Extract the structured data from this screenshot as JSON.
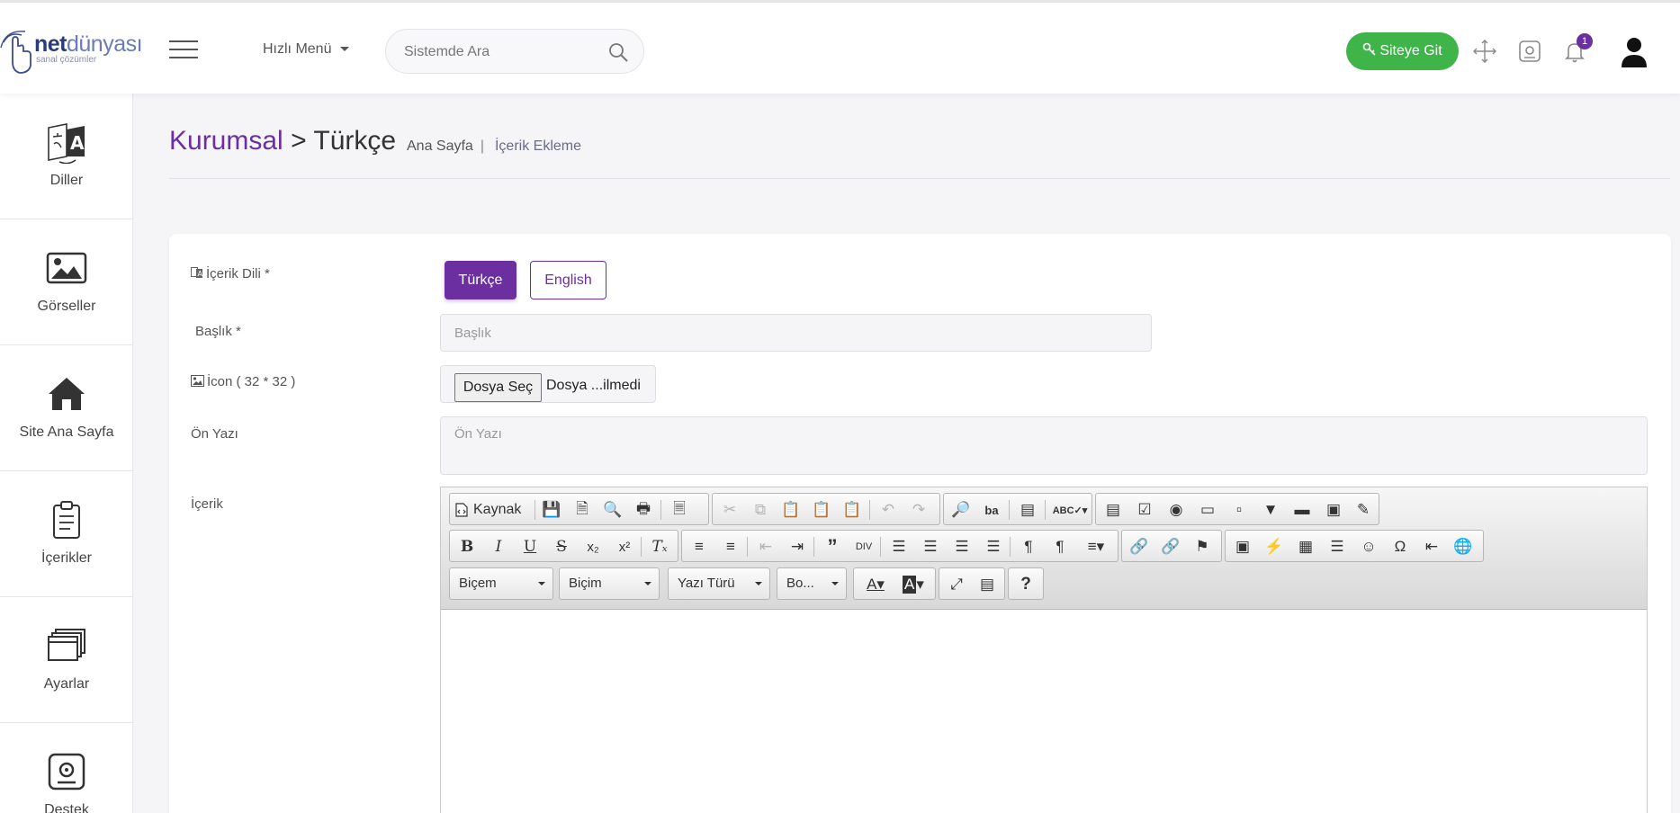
{
  "header": {
    "logo_bold": "net",
    "logo_light": "dünyası",
    "logo_sub": "sanal çözümler",
    "quick_menu": "Hızlı Menü",
    "search_placeholder": "Sistemde Ara",
    "site_button": "Siteye Git",
    "notification_count": "1"
  },
  "sidebar": {
    "items": [
      {
        "label": "Diller",
        "icon": "translate-icon"
      },
      {
        "label": "Görseller",
        "icon": "image-icon"
      },
      {
        "label": "Site Ana Sayfa",
        "icon": "home-icon"
      },
      {
        "label": "İçerikler",
        "icon": "clipboard-icon"
      },
      {
        "label": "Ayarlar",
        "icon": "windows-stack-icon"
      },
      {
        "label": "Destek",
        "icon": "safe-icon"
      }
    ]
  },
  "page": {
    "category": "Kurumsal",
    "arrow": ">",
    "language": "Türkçe",
    "breadcrumb_home": "Ana Sayfa",
    "breadcrumb_sep": "|",
    "breadcrumb_current": "İçerik Ekleme"
  },
  "form": {
    "content_lang_label": "İçerik Dili *",
    "lang_tr": "Türkçe",
    "lang_en": "English",
    "title_label": "Başlık *",
    "title_placeholder": "Başlık",
    "icon_label": "İcon ( 32 * 32 )",
    "file_button": "Dosya Seç",
    "file_status": "Dosya ...ilmedi",
    "summary_label": "Ön Yazı",
    "summary_placeholder": "Ön Yazı",
    "content_label": "İçerik"
  },
  "editor": {
    "source_label": "Kaynak",
    "combo_format": "Biçem",
    "combo_style": "Biçim",
    "combo_font": "Yazı Türü",
    "combo_size": "Bo..."
  },
  "colors": {
    "accent": "#6b2fa0",
    "success": "#3fb549"
  }
}
